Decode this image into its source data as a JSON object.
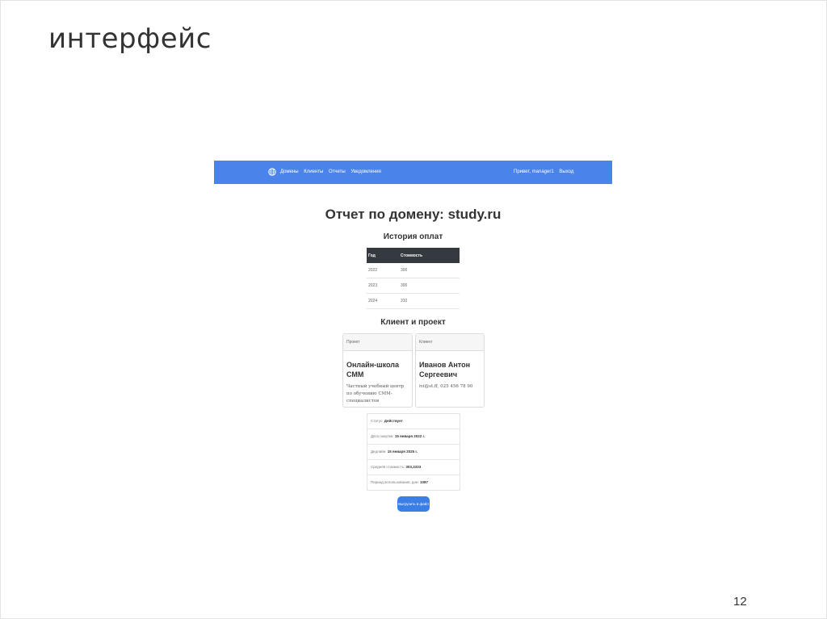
{
  "slide": {
    "title": "интерфейс",
    "page_number": "12"
  },
  "app": {
    "accent_color": "#4a84ea",
    "navbar": {
      "logo_icon": "globe-icon",
      "links": [
        "Домены",
        "Клиенты",
        "Отчеты",
        "Уведомления"
      ],
      "user_label": "Привет, manager1",
      "logout_label": "Выход"
    },
    "report_title": "Отчет по домену: study.ru",
    "payments": {
      "title": "История оплат",
      "columns": [
        "Год",
        "Стоимость"
      ],
      "rows": [
        [
          "2022",
          "300"
        ],
        [
          "2023",
          "300"
        ],
        [
          "2024",
          "310"
        ]
      ]
    },
    "client_project": {
      "title": "Клиент и проект",
      "project": {
        "header": "Проект",
        "name": "Онлайн-школа СММ",
        "description": "Частный учебный центр по обучению СММ-специалистов"
      },
      "client": {
        "header": "Клиент",
        "name": "Иванов Антон Сергеевич",
        "contact": "ivi@st.ff, 025 456 78 90"
      }
    },
    "details": [
      {
        "label": "Статус: ",
        "value": "Действует"
      },
      {
        "label": "Дата покупки: ",
        "value": "15 января 2022 г."
      },
      {
        "label": "Дедлайн: ",
        "value": "15 января 2025 г."
      },
      {
        "label": "Средняя стоимость: ",
        "value": "303,3333"
      },
      {
        "label": "Период использования, дни: ",
        "value": "1087"
      }
    ],
    "download_button": "Выгрузить в файл"
  }
}
